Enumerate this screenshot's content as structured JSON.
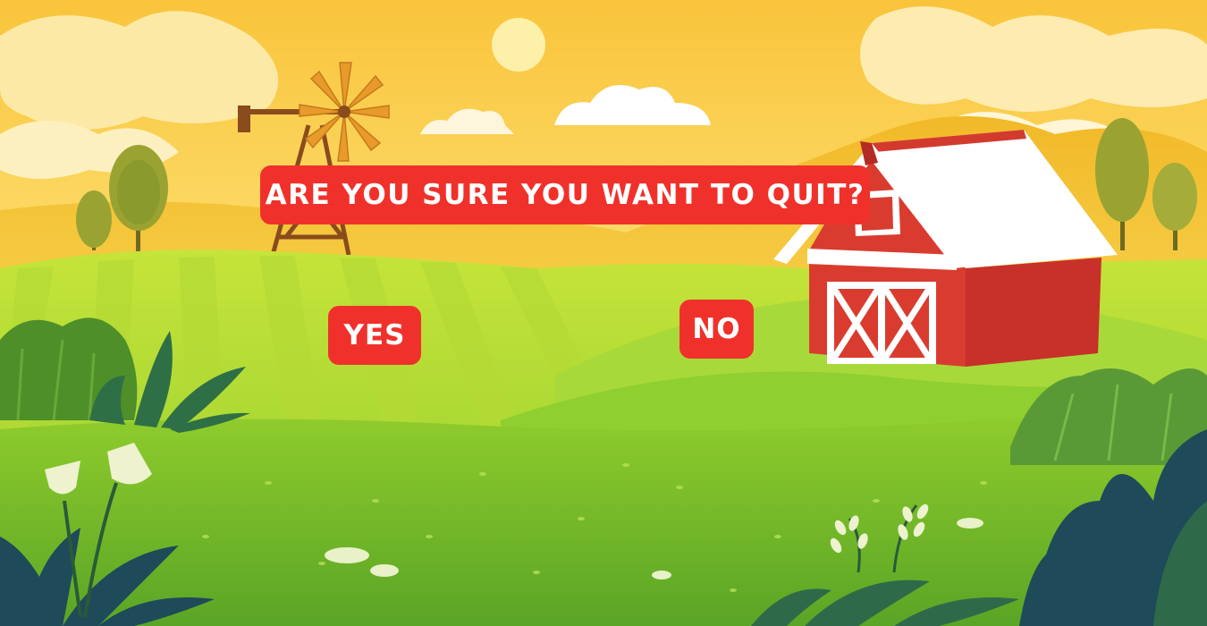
{
  "dialog": {
    "question": "ARE YOU SURE YOU WANT TO QUIT?",
    "yes_label": "YES",
    "no_label": "NO"
  },
  "colors": {
    "button_red": "#f0312b",
    "text_white": "#ffffff",
    "sky_yellow": "#fbd64a",
    "grass_green": "#8fcc2c",
    "barn_red": "#d33a2e"
  },
  "scene": {
    "elements": [
      "sun-icon",
      "windmill-icon",
      "barn-icon",
      "tree-icon",
      "bush-icon",
      "flower-icon",
      "cloud-icon"
    ]
  }
}
